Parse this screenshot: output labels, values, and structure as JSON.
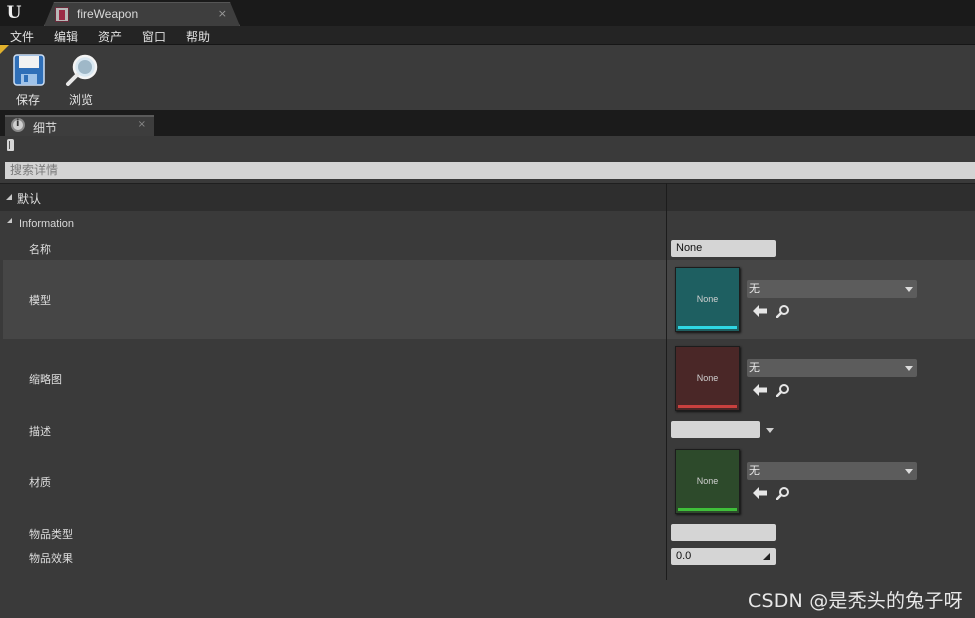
{
  "window": {
    "tab_title": "fireWeapon",
    "close_glyph": "×",
    "logo_glyph": "U"
  },
  "menu": {
    "items": [
      "文件",
      "编辑",
      "资产",
      "窗口",
      "帮助"
    ]
  },
  "toolbar": {
    "save_label": "保存",
    "browse_label": "浏览"
  },
  "details_tab": {
    "label": "细节",
    "close_glyph": "×"
  },
  "search": {
    "placeholder": "搜索详情"
  },
  "category": {
    "label": "默认",
    "subcategory": "Information"
  },
  "properties": {
    "name": {
      "label": "名称",
      "value": "None"
    },
    "model": {
      "label": "模型",
      "thumb_text": "None",
      "combo_value": "无",
      "color": "#1e5f61",
      "bar_color": "#2fd6e3"
    },
    "thumbnail": {
      "label": "缩略图",
      "thumb_text": "None",
      "combo_value": "无",
      "color": "#4a2727",
      "bar_color": "#c9403e"
    },
    "description": {
      "label": "描述",
      "value": ""
    },
    "material": {
      "label": "材质",
      "thumb_text": "None",
      "combo_value": "无",
      "color": "#2d4a2b",
      "bar_color": "#3fbf3a"
    },
    "item_type": {
      "label": "物品类型",
      "value": ""
    },
    "item_effect": {
      "label": "物品效果",
      "value": "0.0"
    }
  },
  "watermark": "CSDN @是秃头的兔子呀"
}
